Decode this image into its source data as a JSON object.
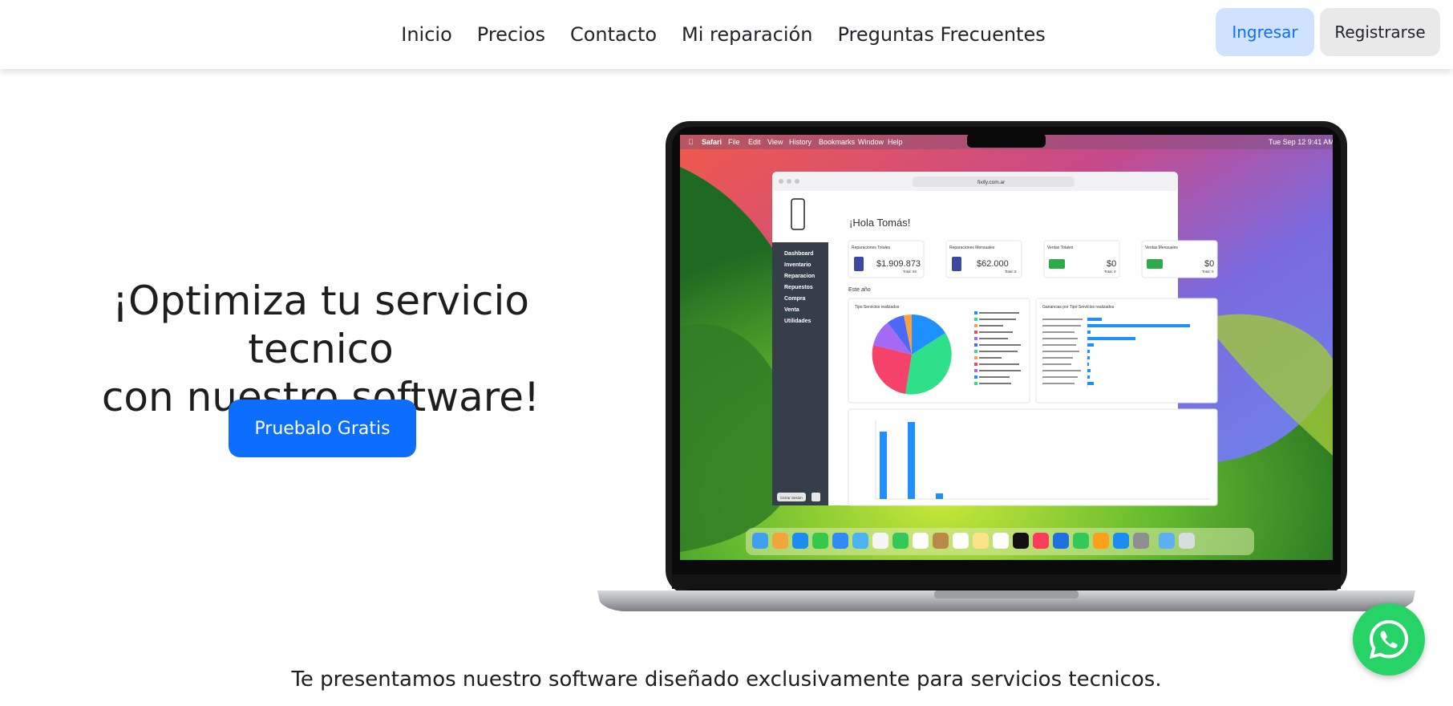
{
  "nav": {
    "links": [
      "Inicio",
      "Precios",
      "Contacto",
      "Mi reparación",
      "Preguntas Frecuentes"
    ],
    "login_label": "Ingresar",
    "register_label": "Registrarse"
  },
  "hero": {
    "title_line1": "¡Optimiza tu servicio tecnico",
    "title_line2": "con nuestro software!",
    "cta_label": "Pruebalo Gratis"
  },
  "subtitle": "Te presentamos nuestro software diseñado exclusivamente para servicios tecnicos.",
  "mockup": {
    "menubar": [
      "Safari",
      "File",
      "Edit",
      "View",
      "History",
      "Bookmarks",
      "Window",
      "Help"
    ],
    "clock": "Tue Sep 12  9:41 AM",
    "url": "fixify.com.ar",
    "greeting": "¡Hola Tomás!",
    "sidebar": [
      "Dashboard",
      "Inventario",
      "Reparacion",
      "Repuestos",
      "Compra",
      "Venta",
      "Utilidades"
    ],
    "logout": "Cerrar Sesion",
    "cards": [
      {
        "label": "Reparaciones Totales",
        "value": "$1.909.873",
        "sub": "Total: 92"
      },
      {
        "label": "Reparaciones Mensuales",
        "value": "$62.000",
        "sub": "Total: 3"
      },
      {
        "label": "Ventas Totales",
        "value": "$0",
        "sub": "Total: 0"
      },
      {
        "label": "Ventas Mensuales",
        "value": "$0",
        "sub": "Total: 0"
      }
    ],
    "year_label": "Este año",
    "pie_title": "Tipo Servicios realizados",
    "bar_title": "Ganancias por Tipo Servicios realizados",
    "colors": {
      "accent": "#0d6efd",
      "whatsapp": "#25d366"
    }
  }
}
